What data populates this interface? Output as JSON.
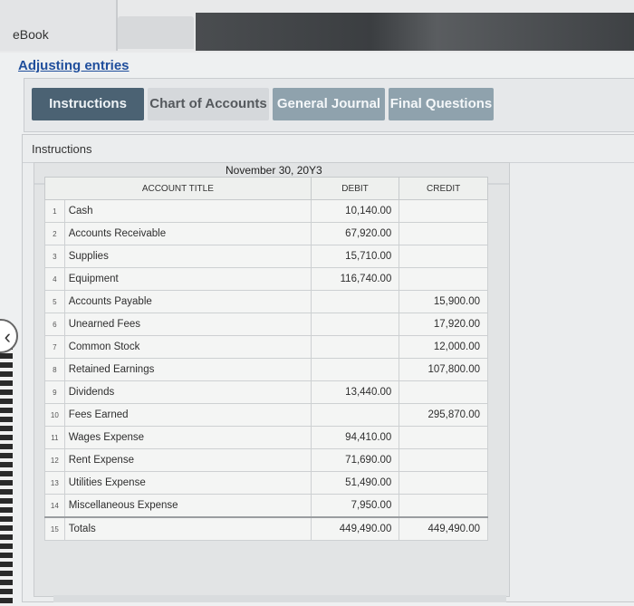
{
  "header": {
    "ebook_label": "eBook"
  },
  "page": {
    "title": "Adjusting entries"
  },
  "tabs": [
    {
      "label": "Instructions"
    },
    {
      "label": "Chart of Accounts"
    },
    {
      "label": "General Journal"
    },
    {
      "label": "Final Questions"
    }
  ],
  "panel": {
    "label": "Instructions",
    "date": "November 30, 20Y3"
  },
  "table": {
    "headers": {
      "account": "ACCOUNT TITLE",
      "debit": "DEBIT",
      "credit": "CREDIT"
    },
    "rows": [
      {
        "num": "1",
        "account": "Cash",
        "debit": "10,140.00",
        "credit": ""
      },
      {
        "num": "2",
        "account": "Accounts Receivable",
        "debit": "67,920.00",
        "credit": ""
      },
      {
        "num": "3",
        "account": "Supplies",
        "debit": "15,710.00",
        "credit": ""
      },
      {
        "num": "4",
        "account": "Equipment",
        "debit": "116,740.00",
        "credit": ""
      },
      {
        "num": "5",
        "account": "Accounts Payable",
        "debit": "",
        "credit": "15,900.00"
      },
      {
        "num": "6",
        "account": "Unearned Fees",
        "debit": "",
        "credit": "17,920.00"
      },
      {
        "num": "7",
        "account": "Common Stock",
        "debit": "",
        "credit": "12,000.00"
      },
      {
        "num": "8",
        "account": "Retained Earnings",
        "debit": "",
        "credit": "107,800.00"
      },
      {
        "num": "9",
        "account": "Dividends",
        "debit": "13,440.00",
        "credit": ""
      },
      {
        "num": "10",
        "account": "Fees Earned",
        "debit": "",
        "credit": "295,870.00"
      },
      {
        "num": "11",
        "account": "Wages Expense",
        "debit": "94,410.00",
        "credit": ""
      },
      {
        "num": "12",
        "account": "Rent Expense",
        "debit": "71,690.00",
        "credit": ""
      },
      {
        "num": "13",
        "account": "Utilities Expense",
        "debit": "51,490.00",
        "credit": ""
      },
      {
        "num": "14",
        "account": "Miscellaneous Expense",
        "debit": "7,950.00",
        "credit": ""
      },
      {
        "num": "15",
        "account": "Totals",
        "debit": "449,490.00",
        "credit": "449,490.00"
      }
    ]
  },
  "icons": {
    "back": "chevron-left-icon"
  },
  "colors": {
    "active_tab": "#4b6273",
    "inactive_tab": "#8fa2ad",
    "title_link": "#1f4e9c"
  }
}
